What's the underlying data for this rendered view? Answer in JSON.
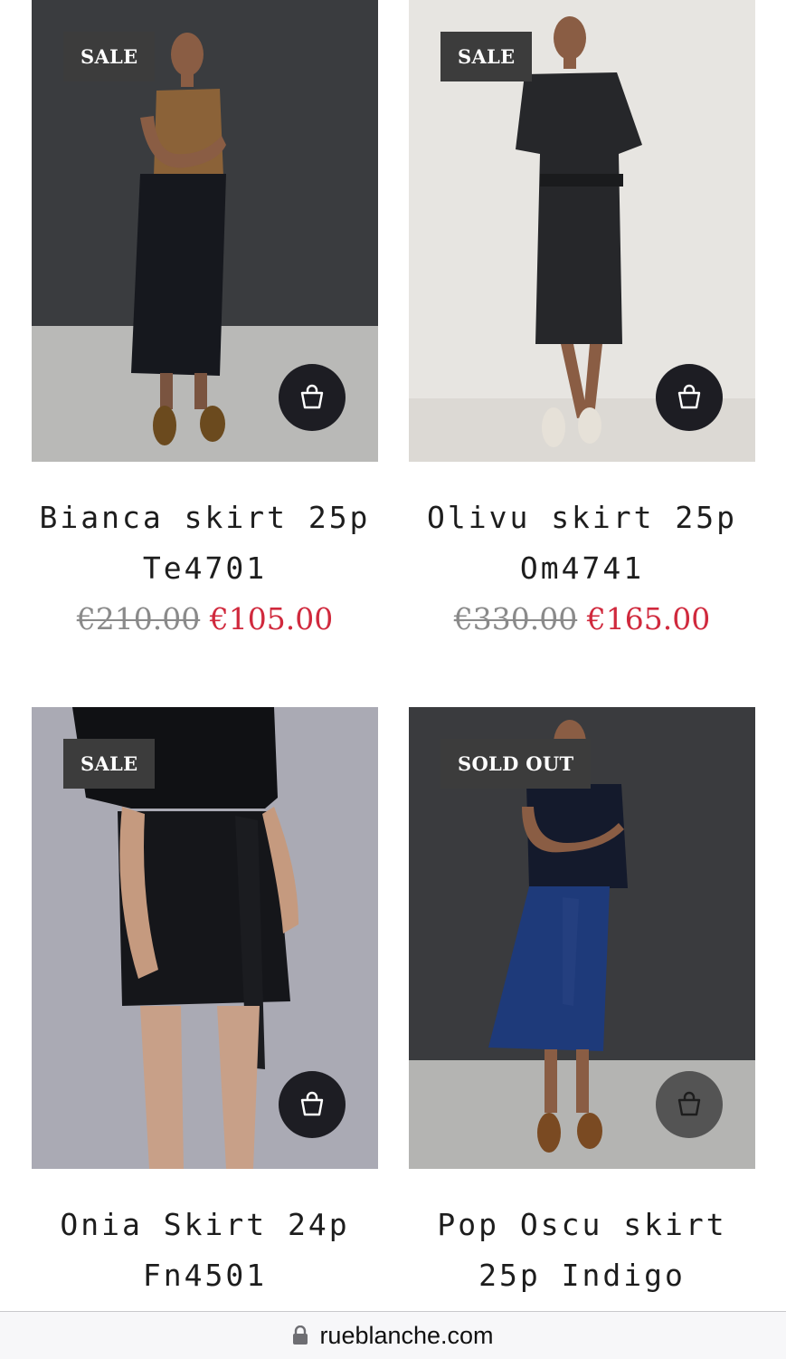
{
  "products": [
    {
      "title": "Bianca skirt 25p Te4701",
      "badge": "SALE",
      "price_old": "€210.00",
      "price_new": "€105.00",
      "cart_icon": "shopping-bag-icon"
    },
    {
      "title": "Olivu skirt 25p Om4741",
      "badge": "SALE",
      "price_old": "€330.00",
      "price_new": "€165.00",
      "cart_icon": "shopping-bag-icon"
    },
    {
      "title": "Onia Skirt 24p Fn4501",
      "badge": "SALE",
      "cart_icon": "shopping-bag-icon"
    },
    {
      "title": "Pop Oscu skirt 25p Indigo",
      "badge": "SOLD OUT",
      "cart_icon": "shopping-bag-icon"
    }
  ],
  "browser": {
    "url": "rueblanche.com",
    "lock_icon": "lock-icon"
  },
  "colors": {
    "sale_price": "#d0293d",
    "old_price": "#8a8a8a",
    "badge_bg": "#3c3c3c",
    "cart_button": "#1d1d23"
  }
}
